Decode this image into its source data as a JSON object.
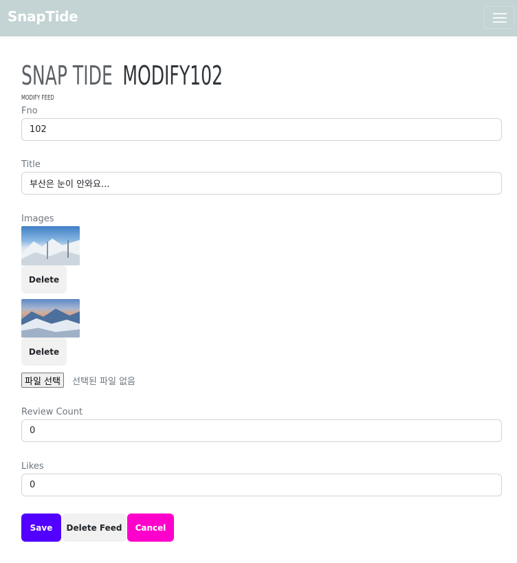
{
  "navbar": {
    "brand": "SnapTide",
    "menu_icon": "hamburger-menu-icon"
  },
  "header": {
    "brand": "SNAP TIDE",
    "modify_title": "MODIFY102",
    "subtitle": "MODIFY FEED"
  },
  "form": {
    "fno": {
      "label": "Fno",
      "value": "102"
    },
    "title": {
      "label": "Title",
      "value": "부산은 눈이 안와요..."
    },
    "images": {
      "label": "Images",
      "items": [
        {
          "alt": "snowy mountain trees",
          "delete_label": "Delete"
        },
        {
          "alt": "snowy valley at sunset",
          "delete_label": "Delete"
        }
      ]
    },
    "file": {
      "button_label": "파일 선택",
      "status": "선택된 파일 없음"
    },
    "review_count": {
      "label": "Review Count",
      "value": "0"
    },
    "likes": {
      "label": "Likes",
      "value": "0"
    }
  },
  "actions": {
    "save": "Save",
    "delete_feed": "Delete Feed",
    "cancel": "Cancel"
  },
  "colors": {
    "navbar_bg": "#c4d3d3",
    "save_bg": "#5200ff",
    "cancel_bg": "#ff00cc"
  }
}
